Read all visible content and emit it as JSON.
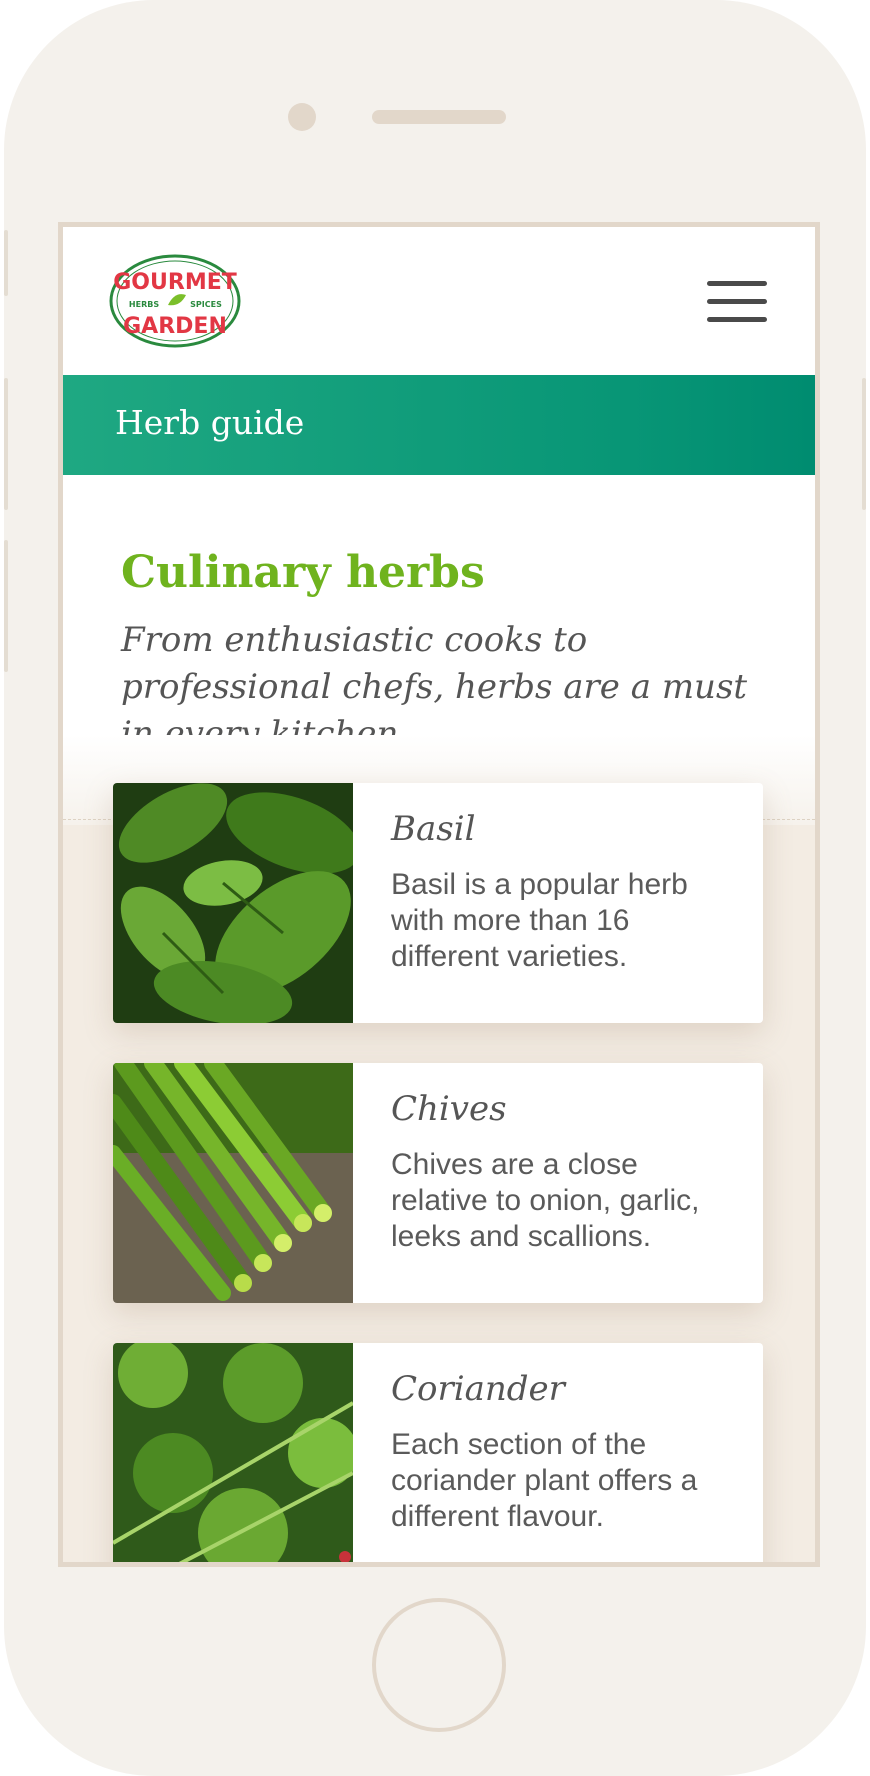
{
  "brand": {
    "logo_top": "GOURMET",
    "logo_bottom": "GARDEN",
    "logo_left": "HERBS",
    "logo_right": "SPICES",
    "colors": {
      "logo_red": "#e23744",
      "logo_green": "#2a8a3e"
    }
  },
  "header": {
    "menu_icon": "hamburger-menu-icon"
  },
  "banner": {
    "title": "Herb guide",
    "color": "#089676"
  },
  "intro": {
    "heading": "Culinary herbs",
    "subtitle": "From enthusiastic cooks to professional chefs, herbs are a must in every kitchen."
  },
  "herbs": [
    {
      "name": "Basil",
      "description": "Basil is a popular herb with more than 16 different varieties."
    },
    {
      "name": "Chives",
      "description": "Chives are a close relative to onion, garlic, leeks and scallions."
    },
    {
      "name": "Coriander",
      "description": "Each section of the coriander plant offers a different flavour."
    }
  ]
}
